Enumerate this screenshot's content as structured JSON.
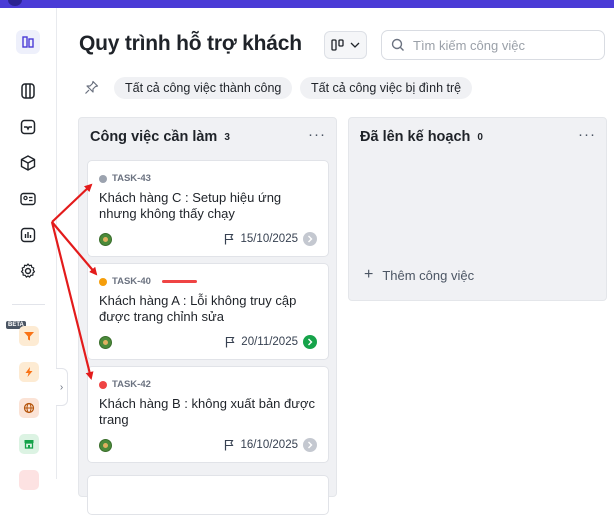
{
  "page": {
    "title": "Quy trình hỗ trợ khách"
  },
  "search": {
    "placeholder": "Tìm kiếm công việc",
    "value": ""
  },
  "filters": [
    {
      "label": "Tất cả công việc thành công"
    },
    {
      "label": "Tất cả công việc bị đình trệ"
    }
  ],
  "sidebar": {
    "icons": [
      "boards-icon",
      "inbox-icon",
      "cube-icon",
      "contact-card-icon",
      "chart-icon",
      "gear-icon"
    ],
    "beta_label": "BETA",
    "apps": [
      "funnel-app-icon",
      "lightning-app-icon",
      "globe-app-icon",
      "store-app-icon"
    ]
  },
  "columns": [
    {
      "title": "Công việc cần làm",
      "count": "3",
      "cards": [
        {
          "id": "TASK-43",
          "status_color": "#9ca3af",
          "title": "Khách hàng C : Setup hiệu ứng nhưng không thấy chạy",
          "due": "15/10/2025",
          "action": "grey"
        },
        {
          "id": "TASK-40",
          "status_color": "#f59e0b",
          "title": "Khách hàng A : Lỗi không truy cập được trang chỉnh sửa",
          "due": "20/11/2025",
          "action": "green"
        },
        {
          "id": "TASK-42",
          "status_color": "#ef4444",
          "title": "Khách hàng B : không xuất bản được trang",
          "due": "16/10/2025",
          "action": "grey"
        }
      ]
    },
    {
      "title": "Đã lên kế hoạch",
      "count": "0",
      "add_label": "Thêm công việc"
    }
  ],
  "colors": {
    "accent": "#4a3bd6",
    "annotation_arrow": "#e31b1b",
    "column_bg": "#f0f1f4"
  }
}
